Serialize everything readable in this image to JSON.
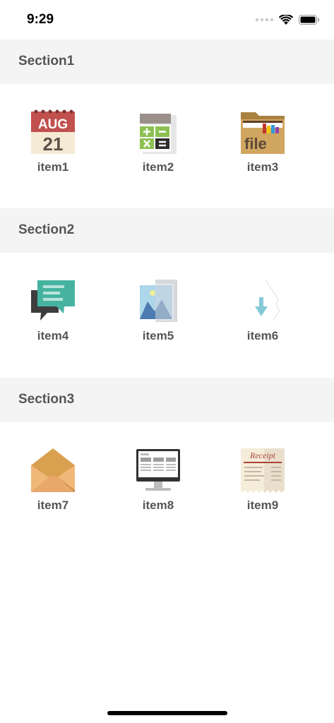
{
  "status_bar": {
    "time": "9:29"
  },
  "sections": [
    {
      "title": "Section1",
      "items": [
        {
          "label": "item1",
          "icon": "calendar-icon",
          "icon_text_top": "AUG",
          "icon_text_bottom": "21"
        },
        {
          "label": "item2",
          "icon": "calculator-icon"
        },
        {
          "label": "item3",
          "icon": "file-folder-icon",
          "icon_text": "file"
        }
      ]
    },
    {
      "title": "Section2",
      "items": [
        {
          "label": "item4",
          "icon": "chat-bubbles-icon"
        },
        {
          "label": "item5",
          "icon": "photo-gallery-icon"
        },
        {
          "label": "item6",
          "icon": "download-arrow-icon"
        }
      ]
    },
    {
      "title": "Section3",
      "items": [
        {
          "label": "item7",
          "icon": "envelope-icon"
        },
        {
          "label": "item8",
          "icon": "desktop-monitor-icon"
        },
        {
          "label": "item9",
          "icon": "receipt-icon",
          "icon_text": "Receipt"
        }
      ]
    }
  ],
  "colors": {
    "section_bg": "#f4f4f4",
    "text": "#555555"
  }
}
